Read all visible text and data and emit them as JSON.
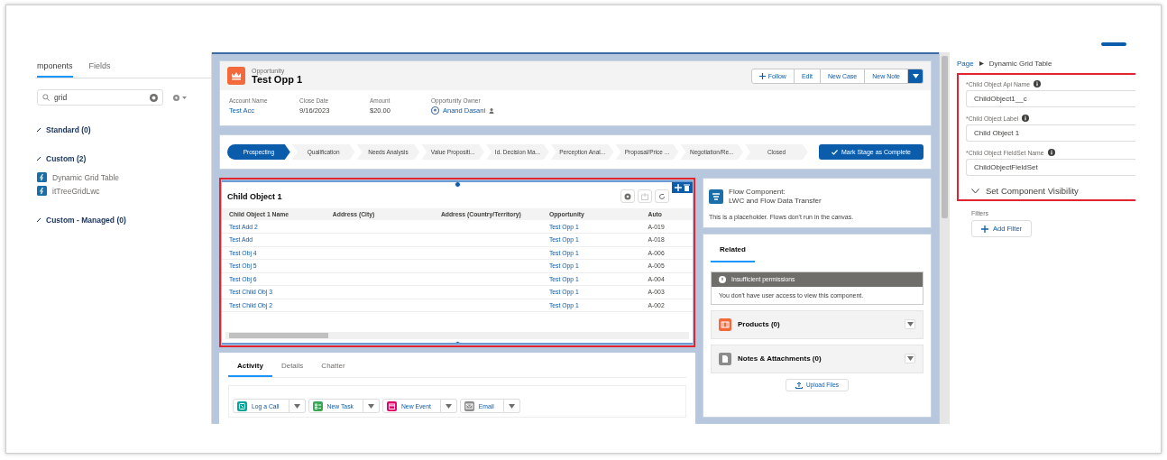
{
  "left_panel": {
    "tabs": [
      {
        "label": "mponents",
        "selected": true
      },
      {
        "label": "Fields",
        "selected": false
      }
    ],
    "search": {
      "value": "grid"
    },
    "sections": [
      {
        "title": "Standard (0)"
      },
      {
        "title": "Custom (2)",
        "items": [
          "Dynamic Grid Table",
          "itTreeGridLwc"
        ]
      },
      {
        "title": "Custom - Managed (0)"
      }
    ]
  },
  "record_header": {
    "object_type": "Opportunity",
    "title": "Test Opp 1",
    "actions": [
      {
        "label": "Follow",
        "kind": "follow"
      },
      {
        "label": "Edit",
        "kind": "plain"
      },
      {
        "label": "New Case",
        "kind": "plain"
      },
      {
        "label": "New Note",
        "kind": "plain"
      }
    ],
    "fields": [
      {
        "label": "Account Name",
        "value": "Test Acc",
        "kind": "link"
      },
      {
        "label": "Close Date",
        "value": "9/16/2023",
        "kind": "text"
      },
      {
        "label": "Amount",
        "value": "$20.00",
        "kind": "text"
      },
      {
        "label": "Opportunity Owner",
        "value": "Anand Dasani",
        "kind": "user"
      }
    ]
  },
  "path": {
    "stages": [
      {
        "label": "Prospecting",
        "selected": true
      },
      {
        "label": "Qualification",
        "selected": false
      },
      {
        "label": "Needs Analysis",
        "selected": false
      },
      {
        "label": "Value Propositi...",
        "selected": false
      },
      {
        "label": "Id. Decision Ma...",
        "selected": false
      },
      {
        "label": "Perception Anal...",
        "selected": false
      },
      {
        "label": "Proposal/Price ...",
        "selected": false
      },
      {
        "label": "Negotiation/Re...",
        "selected": false
      },
      {
        "label": "Closed",
        "selected": false
      }
    ],
    "complete_button": "Mark Stage as Complete"
  },
  "grid_table": {
    "title": "Child Object 1",
    "columns": [
      "Child Object 1 Name",
      "Address (City)",
      "Address (Country/Territory)",
      "Opportunity",
      "Auto"
    ],
    "rows": [
      {
        "name": "Test Add 2",
        "opportunity": "Test Opp 1",
        "auto_number": "A-019"
      },
      {
        "name": "Test Add",
        "opportunity": "Test Opp 1",
        "auto_number": "A-018"
      },
      {
        "name": "Test Obj 4",
        "opportunity": "Test Opp 1",
        "auto_number": "A-006"
      },
      {
        "name": "Test Obj 5",
        "opportunity": "Test Opp 1",
        "auto_number": "A-005"
      },
      {
        "name": "Test Obj 6",
        "opportunity": "Test Opp 1",
        "auto_number": "A-004"
      },
      {
        "name": "Test Child Obj 3",
        "opportunity": "Test Opp 1",
        "auto_number": "A-003"
      },
      {
        "name": "Test Child Obj 2",
        "opportunity": "Test Opp 1",
        "auto_number": "A-002"
      }
    ]
  },
  "activity": {
    "tabs": [
      {
        "label": "Activity",
        "selected": true
      },
      {
        "label": "Details",
        "selected": false
      },
      {
        "label": "Chatter",
        "selected": false
      }
    ],
    "actions": [
      {
        "label": "Log a Call",
        "kind": "call"
      },
      {
        "label": "New Task",
        "kind": "task"
      },
      {
        "label": "New Event",
        "kind": "event"
      },
      {
        "label": "Email",
        "kind": "email"
      }
    ]
  },
  "flow": {
    "title": "Flow Component:",
    "subtitle": "LWC and Flow Data Transfer",
    "note": "This is a placeholder. Flows don't run in the canvas."
  },
  "related": {
    "tabs": [
      {
        "label": "Related",
        "selected": true
      }
    ],
    "permission_title": "Insufficient permissions",
    "permission_message": "You don't have user access to view this component.",
    "lists": [
      {
        "title": "Products (0)",
        "kind": "products"
      },
      {
        "title": "Notes & Attachments (0)",
        "kind": "notes"
      }
    ],
    "upload_button": "Upload Files"
  },
  "properties": {
    "breadcrumb": [
      "Page",
      "Dynamic Grid Table"
    ],
    "fields": [
      {
        "label": "*Child Object Api Name",
        "value": "ChildObject1__c"
      },
      {
        "label": "*Child Object Label",
        "value": "Child Object 1"
      },
      {
        "label": "*Child Object FieldSet Name",
        "value": "ChildObjectFieldSet"
      }
    ],
    "visibility": "Set Component Visibility",
    "filters_label": "Filters",
    "add_filter": "Add Filter"
  }
}
